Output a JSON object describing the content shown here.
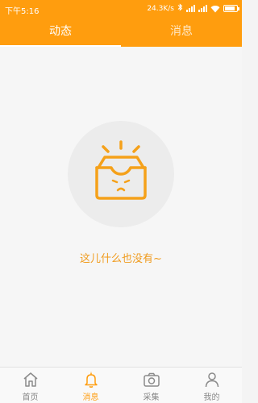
{
  "status_bar": {
    "time": "下午5:16",
    "speed": "24.3K/s",
    "battery_level": 0.85
  },
  "tabs": [
    {
      "label": "动态",
      "active": true
    },
    {
      "label": "消息",
      "active": false
    }
  ],
  "empty_state": {
    "message": "这儿什么也没有~",
    "icon": "empty-box-illustration"
  },
  "bottom_nav": [
    {
      "label": "首页",
      "icon": "home-icon",
      "active": false
    },
    {
      "label": "消息",
      "icon": "bell-icon",
      "active": true
    },
    {
      "label": "采集",
      "icon": "camera-icon",
      "active": false
    },
    {
      "label": "我的",
      "icon": "user-icon",
      "active": false
    }
  ],
  "colors": {
    "accent": "#ff9d0e",
    "text_accent": "#f09b1d",
    "nav_inactive": "#888888"
  }
}
